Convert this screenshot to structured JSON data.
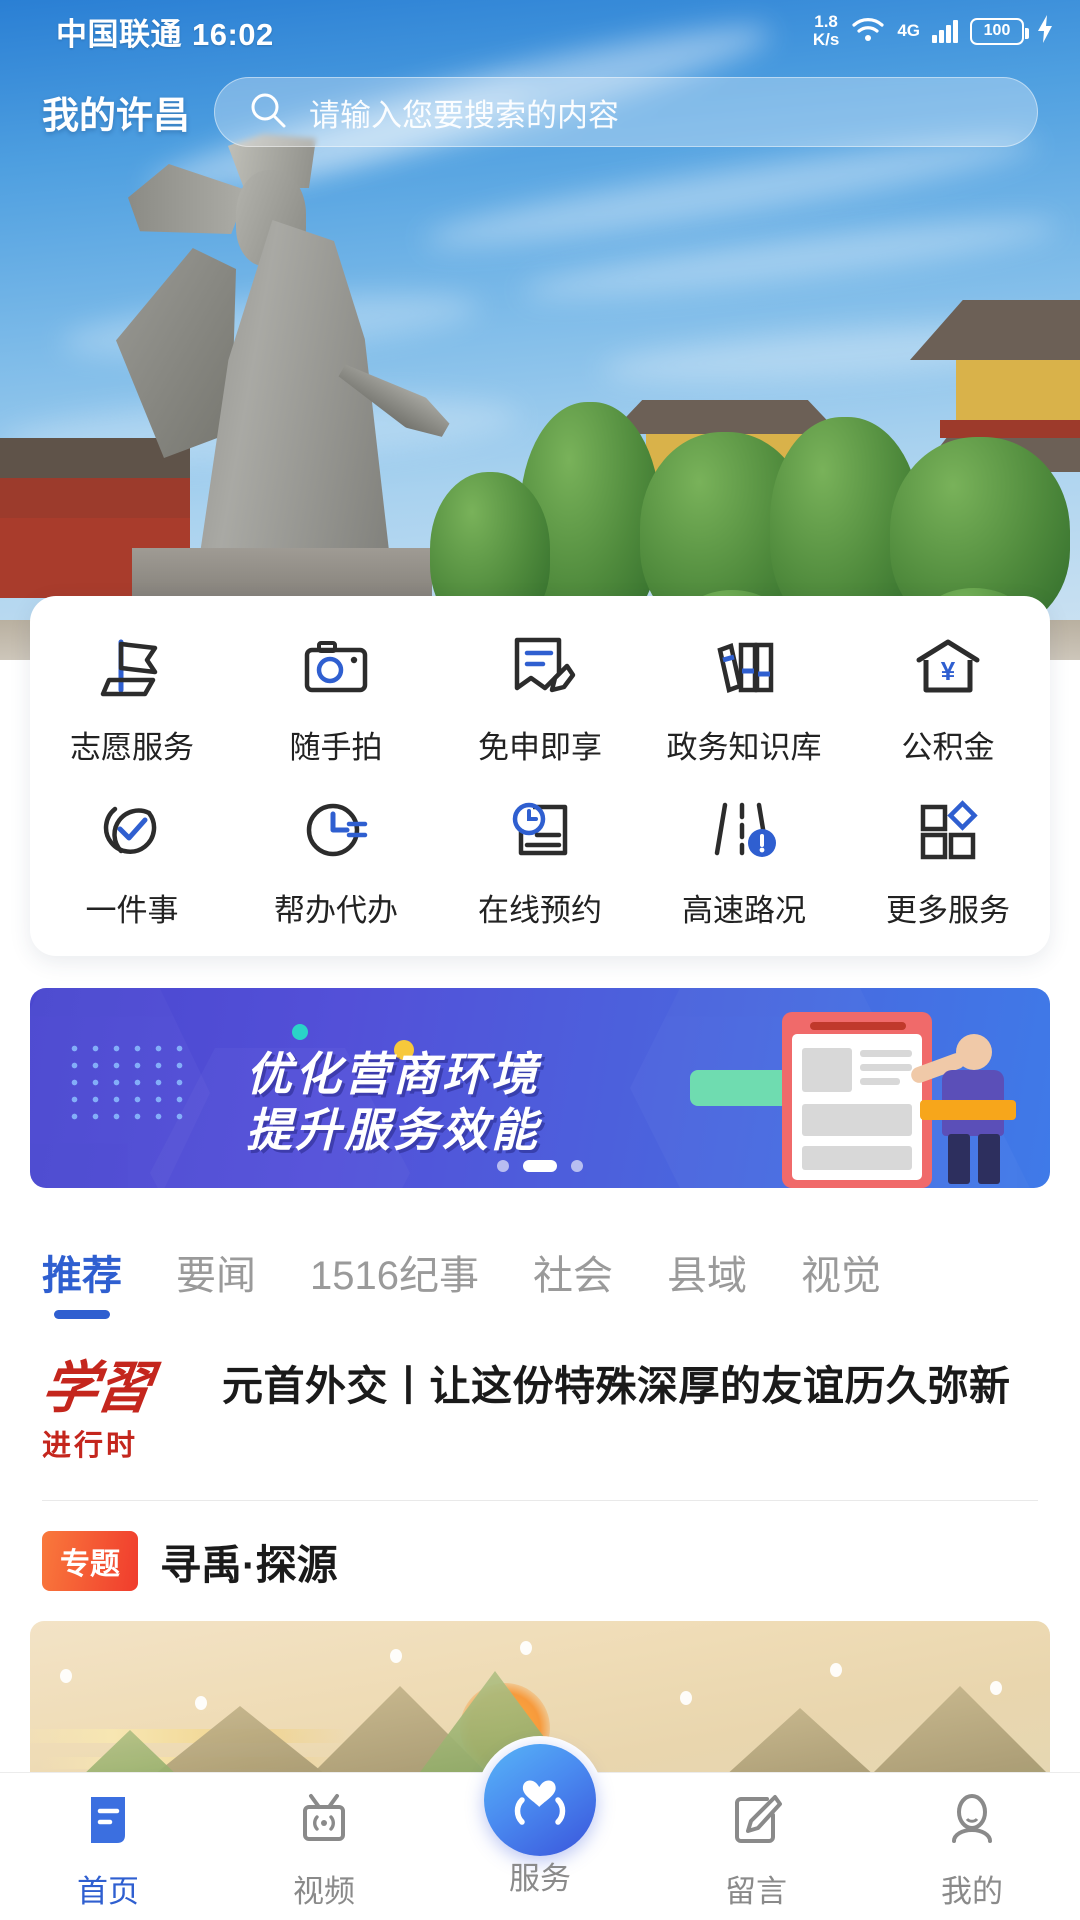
{
  "statusbar": {
    "carrier": "中国联通",
    "time": "16:02",
    "netspeed_value": "1.8",
    "netspeed_unit": "K/s",
    "network_type": "4G",
    "battery": "100",
    "icons": [
      "wifi-icon",
      "signal-bars-icon",
      "battery-icon",
      "charging-bolt-icon"
    ]
  },
  "header": {
    "app_title": "我的许昌",
    "search_placeholder": "请输入您要搜索的内容",
    "search_icon": "search-icon"
  },
  "services": {
    "row1": [
      {
        "label": "志愿服务",
        "icon": "flag-icon"
      },
      {
        "label": "随手拍",
        "icon": "camera-icon"
      },
      {
        "label": "免申即享",
        "icon": "document-pen-icon"
      },
      {
        "label": "政务知识库",
        "icon": "books-icon"
      },
      {
        "label": "公积金",
        "icon": "house-yuan-icon"
      }
    ],
    "row2": [
      {
        "label": "一件事",
        "icon": "circle-check-icon"
      },
      {
        "label": "帮办代办",
        "icon": "clock-lines-icon"
      },
      {
        "label": "在线预约",
        "icon": "clock-document-icon"
      },
      {
        "label": "高速路况",
        "icon": "road-alert-icon"
      },
      {
        "label": "更多服务",
        "icon": "grid-more-icon"
      }
    ]
  },
  "promo": {
    "line1": "优化营商环境",
    "line2": "提升服务效能",
    "pagination": {
      "total": 3,
      "active_index": 1
    },
    "colors": {
      "bg_start": "#4a47cf",
      "bg_end": "#3f7ae8",
      "highlight": "#f7a61b"
    }
  },
  "tabs": {
    "items": [
      {
        "label": "推荐",
        "active": true
      },
      {
        "label": "要闻",
        "active": false
      },
      {
        "label": "1516纪事",
        "active": false
      },
      {
        "label": "社会",
        "active": false
      },
      {
        "label": "县域",
        "active": false
      },
      {
        "label": "视觉",
        "active": false
      }
    ],
    "active_color": "#2f5fd0"
  },
  "feed": {
    "news": {
      "badge_top": "学習",
      "badge_bottom": "进行时",
      "title": "元首外交丨让这份特殊深厚的友谊历久弥新"
    },
    "topic": {
      "badge": "专题",
      "title": "寻禹·探源",
      "badge_color": "#f03c2d"
    }
  },
  "bottomnav": {
    "items": [
      {
        "label": "首页",
        "icon": "home-doc-icon",
        "active": true
      },
      {
        "label": "视频",
        "icon": "tv-icon",
        "active": false
      },
      {
        "label": "服务",
        "icon": "heart-hands-icon",
        "active": false,
        "center": true
      },
      {
        "label": "留言",
        "icon": "pencil-note-icon",
        "active": false
      },
      {
        "label": "我的",
        "icon": "person-icon",
        "active": false
      }
    ],
    "active_color": "#2f5fd0"
  }
}
